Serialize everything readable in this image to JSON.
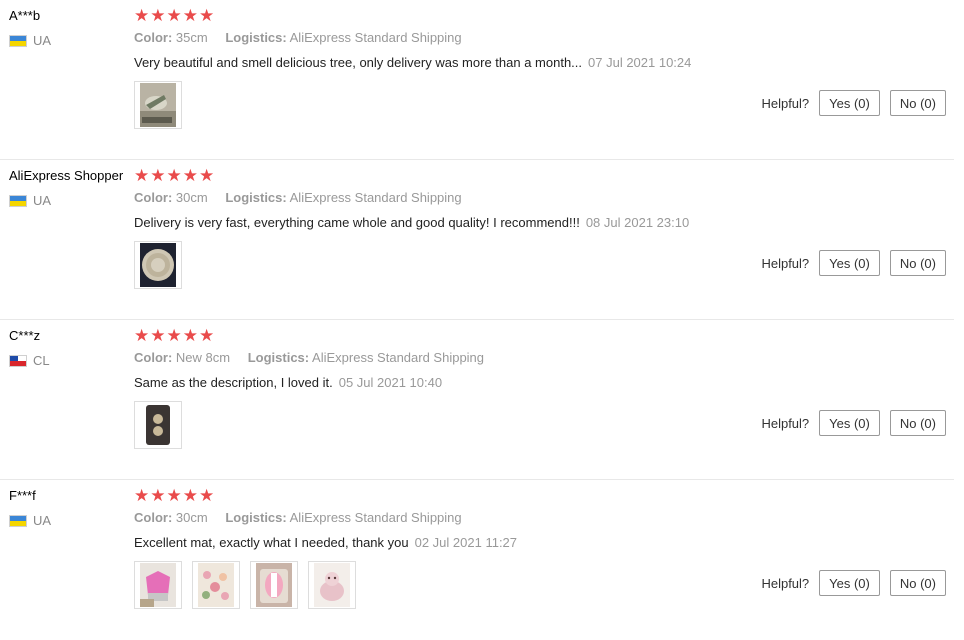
{
  "colors": {
    "star": "#e94b4b",
    "muted": "#999999"
  },
  "helpful_label": "Helpful?",
  "reviews": [
    {
      "user": "A***b",
      "country": "UA",
      "flag_icon": "ukraine-flag-icon",
      "stars": 5,
      "color_label": "Color:",
      "color_value": "35cm",
      "logistics_label": "Logistics:",
      "logistics_value": "AliExpress Standard Shipping",
      "text": "Very beautiful and smell delicious tree, only delivery was more than a month...",
      "date": "07 Jul 2021 10:24",
      "yes": "Yes (0)",
      "no": "No (0)",
      "photos": [
        "photo-tree"
      ]
    },
    {
      "user": "AliExpress Shopper",
      "country": "UA",
      "flag_icon": "ukraine-flag-icon",
      "stars": 5,
      "color_label": "Color:",
      "color_value": "30cm",
      "logistics_label": "Logistics:",
      "logistics_value": "AliExpress Standard Shipping",
      "text": "Delivery is very fast, everything came whole and good quality! I recommend!!!",
      "date": "08 Jul 2021 23:10",
      "yes": "Yes (0)",
      "no": "No (0)",
      "photos": [
        "photo-round-mat"
      ]
    },
    {
      "user": "C***z",
      "country": "CL",
      "flag_icon": "chile-flag-icon",
      "stars": 5,
      "color_label": "Color:",
      "color_value": "New 8cm",
      "logistics_label": "Logistics:",
      "logistics_value": "AliExpress Standard Shipping",
      "text": "Same as the description, I loved it.",
      "date": "05 Jul 2021 10:40",
      "yes": "Yes (0)",
      "no": "No (0)",
      "photos": [
        "photo-coasters"
      ]
    },
    {
      "user": "F***f",
      "country": "UA",
      "flag_icon": "ukraine-flag-icon",
      "stars": 5,
      "color_label": "Color:",
      "color_value": "30cm",
      "logistics_label": "Logistics:",
      "logistics_value": "AliExpress Standard Shipping",
      "text": "Excellent mat, exactly what I needed, thank you",
      "date": "02 Jul 2021 11:27",
      "yes": "Yes (0)",
      "no": "No (0)",
      "photos": [
        "photo-pink-1",
        "photo-pink-2",
        "photo-pink-3",
        "photo-pink-4"
      ]
    }
  ]
}
